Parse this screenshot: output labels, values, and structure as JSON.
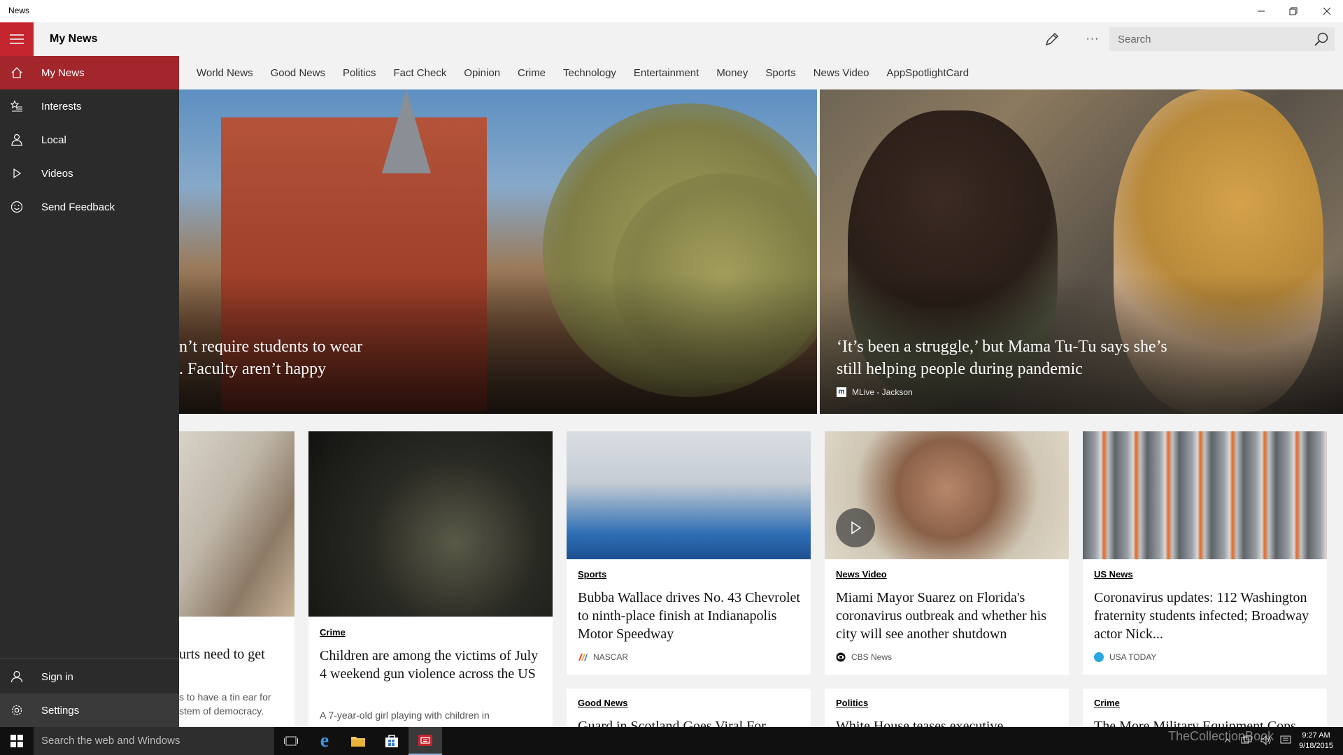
{
  "window": {
    "app_title": "News",
    "controls": {
      "minimize": "—",
      "maximize": "❐",
      "close": "✕"
    }
  },
  "header": {
    "page_title": "My News",
    "edit_icon": "pencil-icon",
    "more_label": "···",
    "search": {
      "placeholder": "Search",
      "value": ""
    }
  },
  "tabs": [
    "World News",
    "Good News",
    "Politics",
    "Fact Check",
    "Opinion",
    "Crime",
    "Technology",
    "Entertainment",
    "Money",
    "Sports",
    "News Video",
    "AppSpotlightCard"
  ],
  "nav": {
    "items": [
      {
        "label": "My News",
        "icon": "home-icon",
        "active": true
      },
      {
        "label": "Interests",
        "icon": "star-list-icon"
      },
      {
        "label": "Local",
        "icon": "person-pin-icon"
      },
      {
        "label": "Videos",
        "icon": "play-icon"
      },
      {
        "label": "Send Feedback",
        "icon": "smiley-icon"
      }
    ],
    "bottom": [
      {
        "label": "Sign in",
        "icon": "person-icon"
      },
      {
        "label": "Settings",
        "icon": "gear-icon"
      }
    ]
  },
  "hero": [
    {
      "headline_line1": "n’t require students to wear",
      "headline_line2": ". Faculty aren’t happy"
    },
    {
      "headline_line1": "‘It’s been a struggle,’ but Mama Tu-Tu says she’s",
      "headline_line2": "still helping people during pandemic",
      "source": "MLive - Jackson"
    }
  ],
  "cards": [
    {
      "title_line": "urts need to get",
      "snippet_line1": "s to have a tin ear for",
      "snippet_line2": "stem of democracy."
    },
    {
      "category": "Crime",
      "title": "Children are among the victims of July 4 weekend gun violence across the US",
      "snippet": "A 7-year-old girl playing with children in"
    },
    {
      "category": "Sports",
      "title": "Bubba Wallace drives No. 43 Chevrolet to ninth-place finish at Indianapolis Motor Speedway",
      "source": "NASCAR"
    },
    {
      "category": "News Video",
      "title": "Miami Mayor Suarez on Florida's coronavirus outbreak and whether his city will see another shutdown",
      "source": "CBS News"
    },
    {
      "category": "US News",
      "title": "Coronavirus updates: 112 Washington fraternity students infected; Broadway actor Nick...",
      "source": "USA TODAY"
    },
    {
      "category": "Good News",
      "title": "Guard in Scotland Goes Viral For"
    },
    {
      "category": "Politics",
      "title": "White House teases executive"
    },
    {
      "category": "Crime",
      "title": "The More Military Equipment Cops"
    }
  ],
  "taskbar": {
    "search_placeholder": "Search the web and Windows",
    "clock_time": "9:27 AM",
    "clock_date": "9/18/2015",
    "watermark": "TheCollectionBook"
  },
  "colors": {
    "accent": "#c4252f",
    "nav_bg": "#2b2b2b",
    "nav_active": "#a3262d"
  }
}
